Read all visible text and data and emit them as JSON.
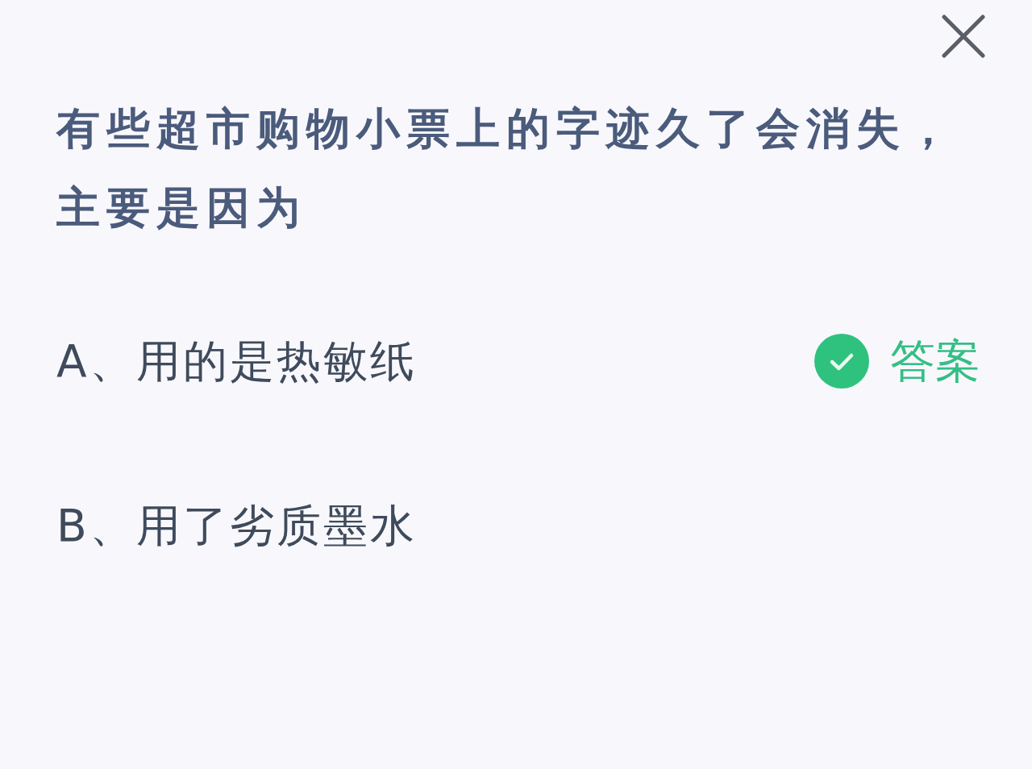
{
  "question": {
    "text": "有些超市购物小票上的字迹久了会消失，主要是因为"
  },
  "options": [
    {
      "text": "A、用的是热敏纸",
      "correct": true
    },
    {
      "text": "B、用了劣质墨水",
      "correct": false
    }
  ],
  "answer_label": "答案"
}
